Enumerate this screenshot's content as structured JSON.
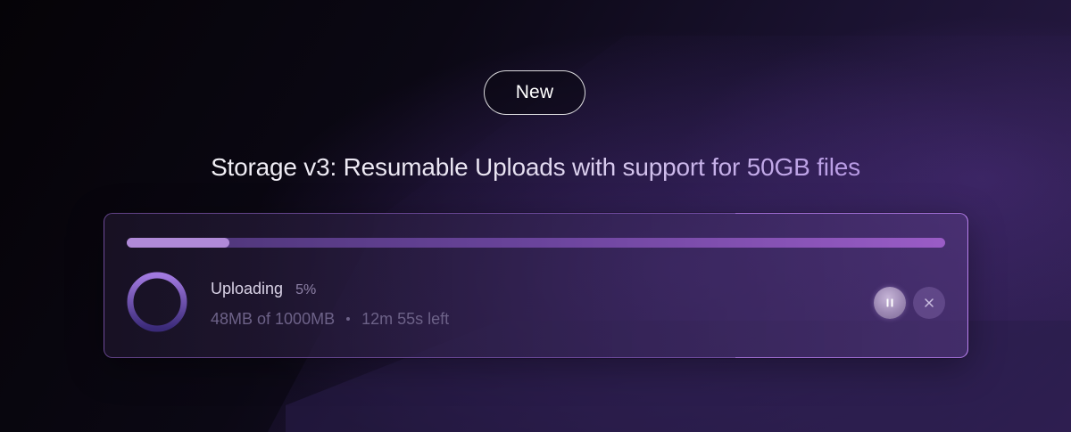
{
  "badge": {
    "label": "New"
  },
  "headline": "Storage v3: Resumable Uploads with support for 50GB files",
  "upload": {
    "status_label": "Uploading",
    "percent_label": "5%",
    "progress_fraction": 0.125,
    "transferred": "48MB of 1000MB",
    "time_left": "12m 55s left"
  },
  "controls": {
    "pause_icon": "pause-icon",
    "close_icon": "close-icon"
  },
  "colors": {
    "accent": "#9a5cc6",
    "ring_start": "#a27ae0",
    "ring_end": "#3a2a78"
  }
}
